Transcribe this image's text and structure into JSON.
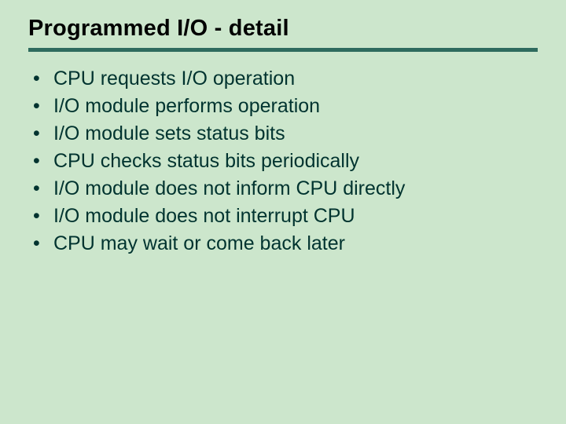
{
  "title": "Programmed I/O - detail",
  "bullets": [
    "CPU requests I/O operation",
    "I/O module performs operation",
    "I/O module sets status bits",
    "CPU checks status bits periodically",
    "I/O module does not inform CPU directly",
    "I/O module does not interrupt CPU",
    "CPU may wait or come back later"
  ]
}
